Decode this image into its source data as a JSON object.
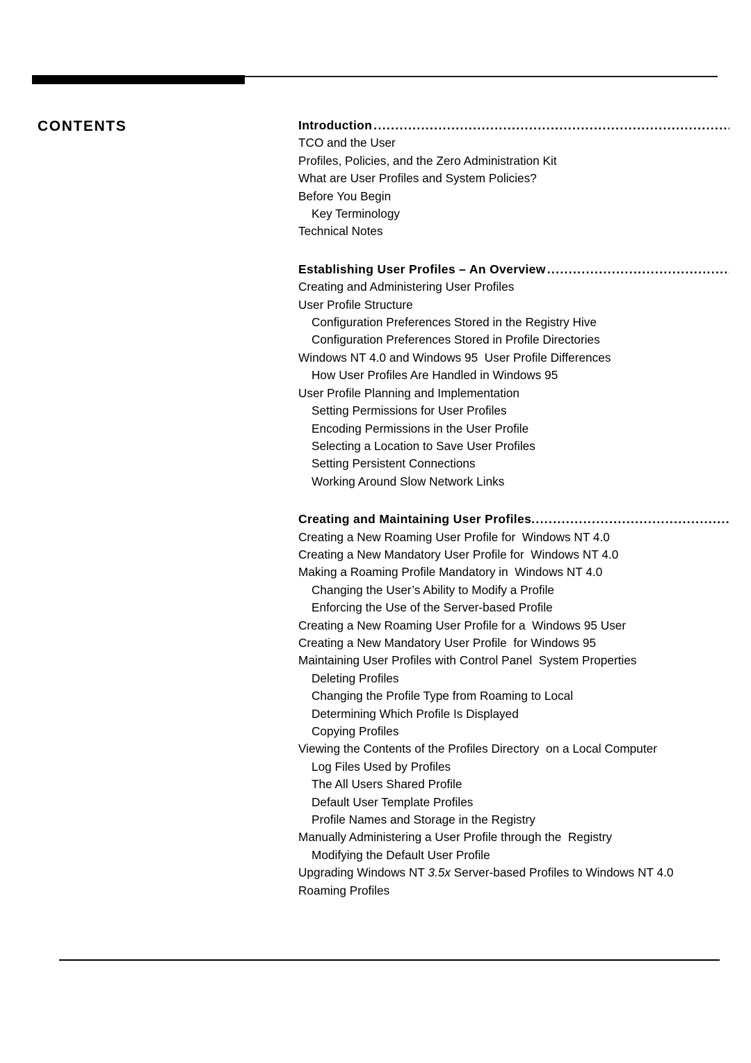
{
  "page": {
    "contents_label": "CONTENTS",
    "leader_dots": "........................................................................................................"
  },
  "toc": {
    "sections": [
      {
        "heading": "Introduction",
        "entries": [
          {
            "text": "TCO and the User",
            "level": 0
          },
          {
            "text": "Profiles, Policies, and the Zero Administration Kit",
            "level": 0
          },
          {
            "text": "What are User Profiles and System Policies?",
            "level": 0
          },
          {
            "text": "Before You Begin",
            "level": 0
          },
          {
            "text": "Key Terminology",
            "level": 1
          },
          {
            "text": "Technical Notes",
            "level": 0
          }
        ]
      },
      {
        "heading": "Establishing User Profiles – An Overview",
        "entries": [
          {
            "text": "Creating and Administering User Profiles",
            "level": 0
          },
          {
            "text": "User Profile Structure",
            "level": 0
          },
          {
            "text": "Configuration Preferences Stored in the Registry Hive",
            "level": 1
          },
          {
            "text": "Configuration Preferences Stored in Profile Directories",
            "level": 1
          },
          {
            "text": "Windows NT 4.0 and Windows 95  User Profile Differences",
            "level": 0
          },
          {
            "text": "How User Profiles Are Handled in Windows 95",
            "level": 1
          },
          {
            "text": "User Profile Planning and Implementation",
            "level": 0
          },
          {
            "text": "Setting Permissions for User Profiles",
            "level": 1
          },
          {
            "text": "Encoding Permissions in the User Profile",
            "level": 1
          },
          {
            "text": "Selecting a Location to Save User Profiles",
            "level": 1
          },
          {
            "text": "Setting Persistent Connections",
            "level": 1
          },
          {
            "text": "Working Around Slow Network Links",
            "level": 1
          }
        ]
      },
      {
        "heading": "Creating and Maintaining User Profiles",
        "entries": [
          {
            "text": "Creating a New Roaming User Profile for  Windows NT 4.0",
            "level": 0
          },
          {
            "text": "Creating a New Mandatory User Profile for  Windows NT 4.0",
            "level": 0
          },
          {
            "text": "Making a Roaming Profile Mandatory in  Windows NT 4.0",
            "level": 0
          },
          {
            "text": "Changing the User’s Ability to Modify a Profile",
            "level": 1
          },
          {
            "text": "Enforcing the Use of the Server-based Profile",
            "level": 1
          },
          {
            "text": "Creating a New Roaming User Profile for a  Windows 95 User",
            "level": 0
          },
          {
            "text": "Creating a New Mandatory User Profile  for Windows 95",
            "level": 0
          },
          {
            "text": "Maintaining User Profiles with Control Panel  System Properties",
            "level": 0
          },
          {
            "text": "Deleting Profiles",
            "level": 1
          },
          {
            "text": "Changing the Profile Type from Roaming to Local",
            "level": 1
          },
          {
            "text": "Determining Which Profile Is Displayed",
            "level": 1
          },
          {
            "text": "Copying Profiles",
            "level": 1
          },
          {
            "text": "Viewing the Contents of the Profiles Directory  on a Local Computer",
            "level": 0
          },
          {
            "text": "Log Files Used by Profiles",
            "level": 1
          },
          {
            "text": "The All Users Shared Profile",
            "level": 1
          },
          {
            "text": "Default User Template Profiles",
            "level": 1
          },
          {
            "text": "Profile Names and Storage in the Registry",
            "level": 1
          },
          {
            "text": "Manually Administering a User Profile through the  Registry",
            "level": 0
          },
          {
            "text": "Modifying the Default User Profile",
            "level": 1
          },
          {
            "text": "Upgrading Windows NT ",
            "italic": "3.5x",
            "text_after": " Server-based Profiles to Windows NT 4.0",
            "level": 0
          },
          {
            "text": "Roaming Profiles",
            "level": 0
          }
        ]
      }
    ]
  }
}
